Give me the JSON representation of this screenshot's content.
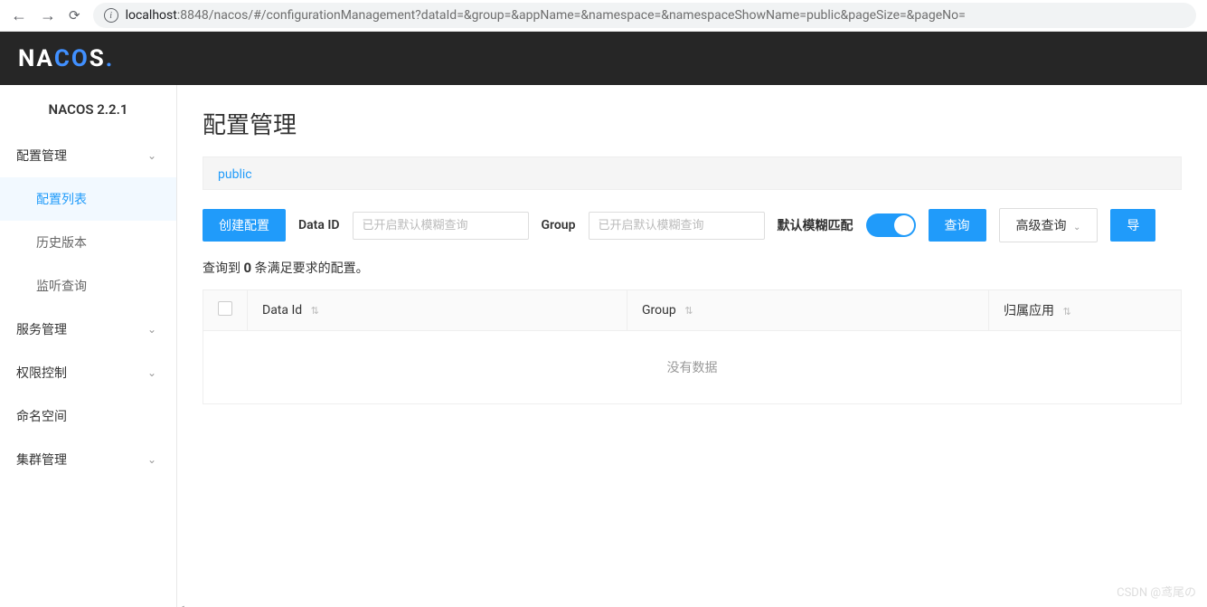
{
  "browser": {
    "url_host": "localhost",
    "url_port_path": ":8848/nacos/#/configurationManagement?dataId=&group=&appName=&namespace=&namespaceShowName=public&pageSize=&pageNo="
  },
  "header": {
    "logo_text": "NACOS."
  },
  "sidebar": {
    "title": "NACOS 2.2.1",
    "items": [
      {
        "label": "配置管理",
        "expandable": true,
        "expanded": true
      },
      {
        "label": "配置列表",
        "sub": true,
        "active": true
      },
      {
        "label": "历史版本",
        "sub": true
      },
      {
        "label": "监听查询",
        "sub": true
      },
      {
        "label": "服务管理",
        "expandable": true
      },
      {
        "label": "权限控制",
        "expandable": true
      },
      {
        "label": "命名空间",
        "expandable": false
      },
      {
        "label": "集群管理",
        "expandable": true
      }
    ]
  },
  "main": {
    "page_title": "配置管理",
    "namespace": "public",
    "create_btn": "创建配置",
    "data_id_label": "Data ID",
    "data_id_placeholder": "已开启默认模糊查询",
    "group_label": "Group",
    "group_placeholder": "已开启默认模糊查询",
    "fuzzy_label": "默认模糊匹配",
    "search_btn": "查询",
    "advanced_btn": "高级查询",
    "export_btn": "导",
    "result_prefix": "查询到",
    "result_count": "0",
    "result_suffix": "条满足要求的配置。",
    "table": {
      "col_data_id": "Data Id",
      "col_group": "Group",
      "col_app": "归属应用",
      "empty_text": "没有数据"
    }
  },
  "watermark": "CSDN @鸢尾の"
}
